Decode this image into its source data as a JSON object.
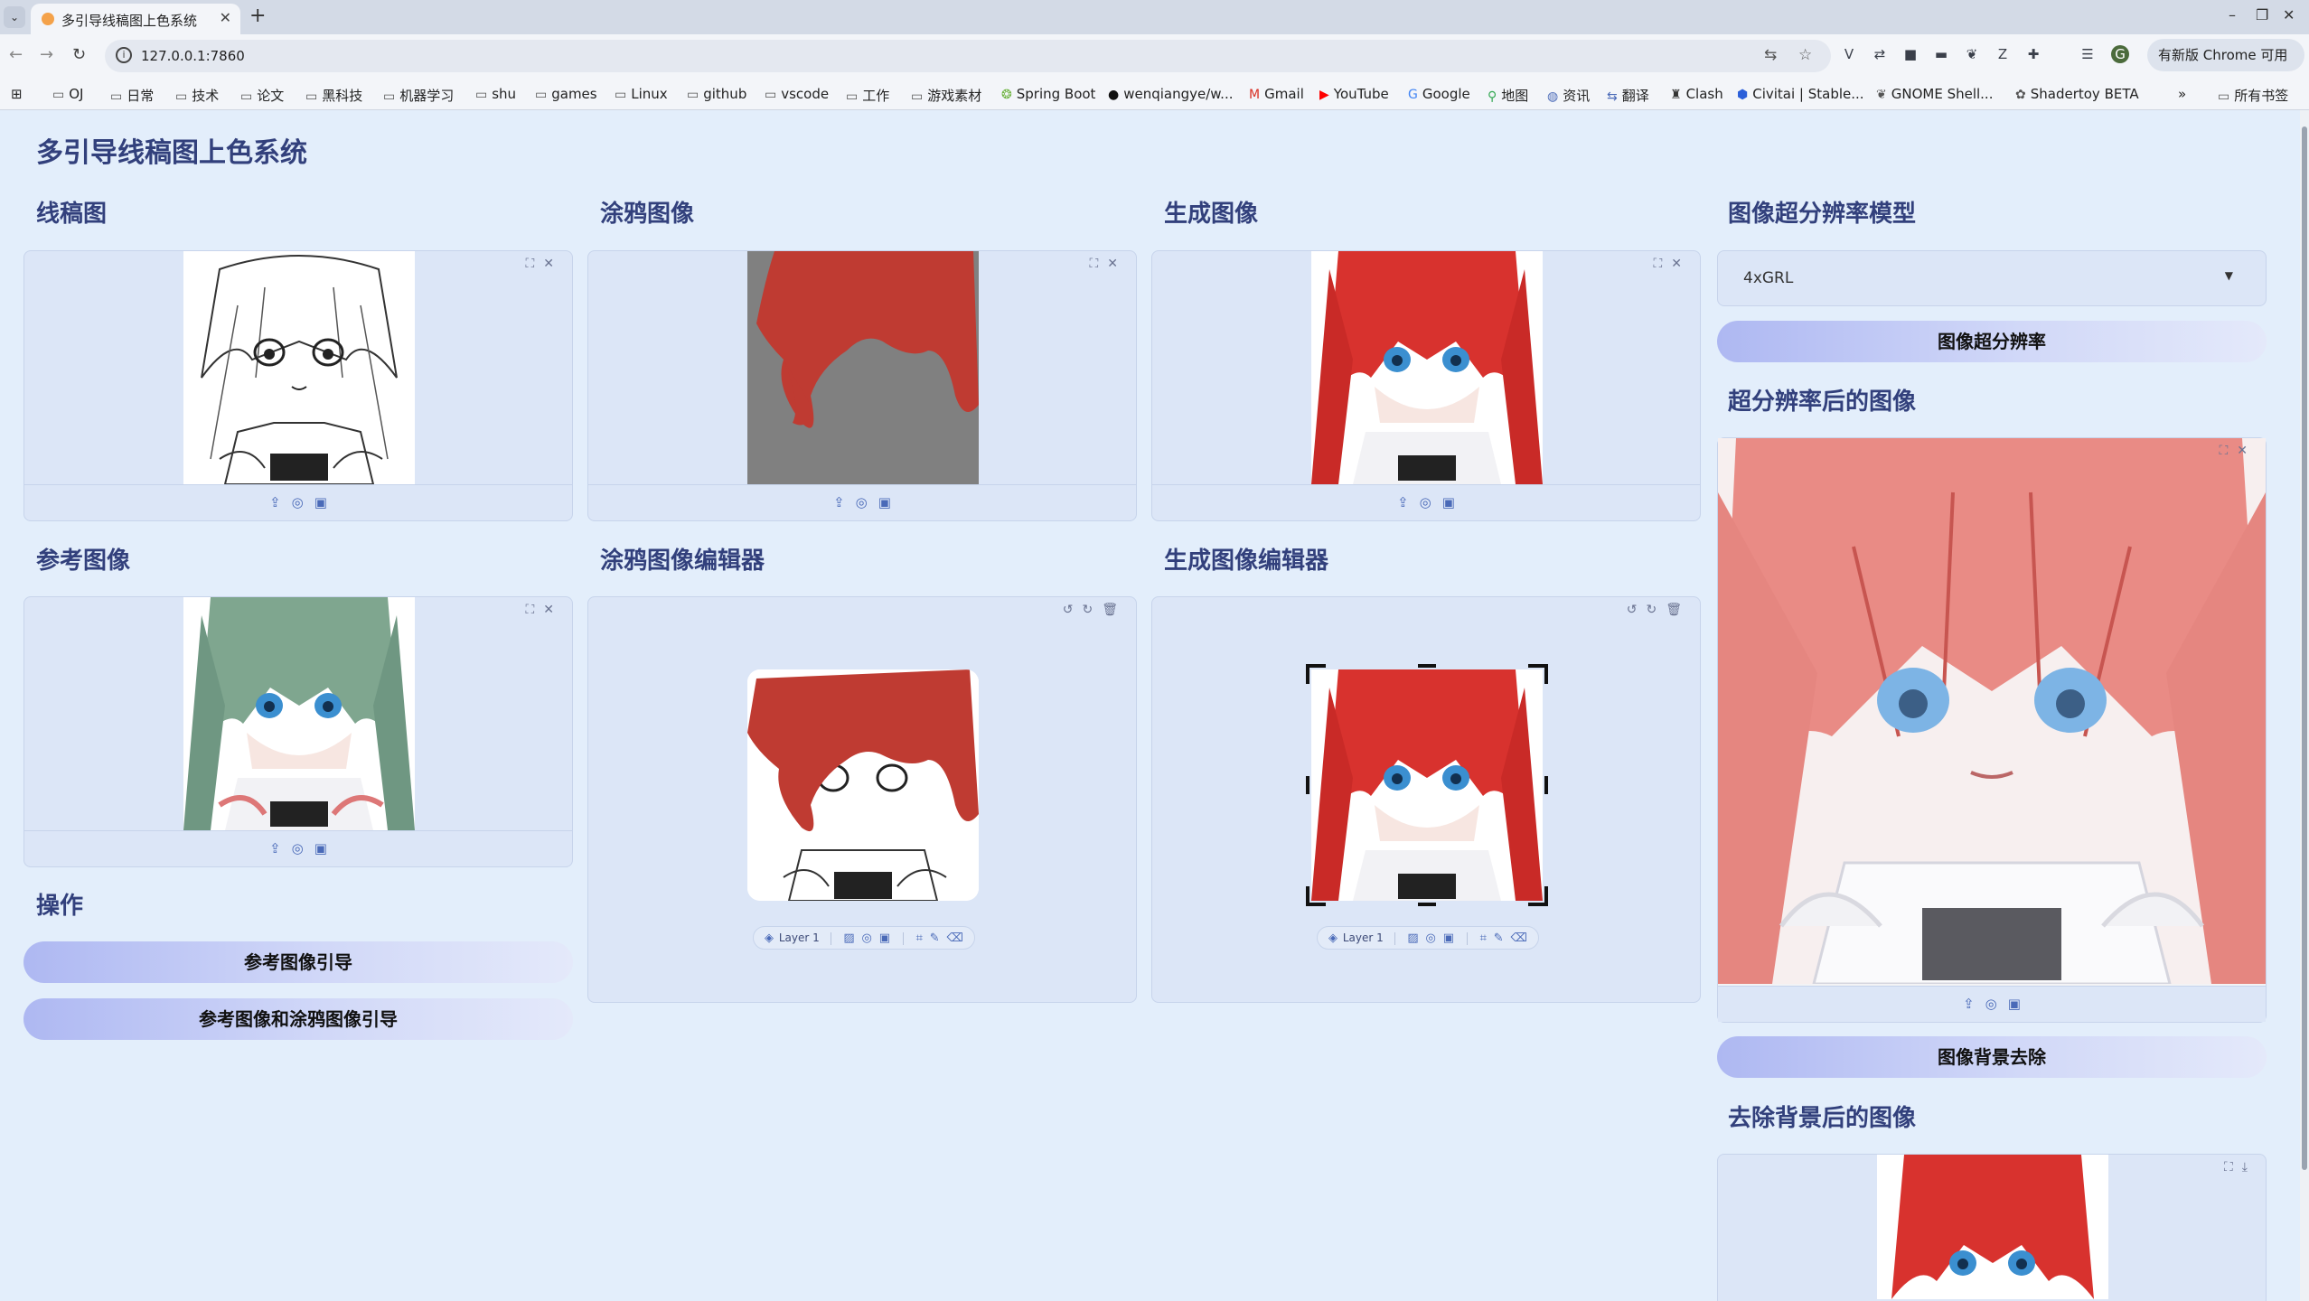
{
  "browser": {
    "tab_title": "多引导线稿图上色系统",
    "url": "127.0.0.1:7860",
    "update_label": "有新版 Chrome 可用",
    "bookmarks": [
      "OJ",
      "日常",
      "技术",
      "论文",
      "黑科技",
      "机器学习",
      "shu",
      "games",
      "Linux",
      "github",
      "vscode",
      "工作",
      "游戏素材",
      "Spring Boot",
      "wenqiangye/w...",
      "Gmail",
      "YouTube",
      "Google",
      "地图",
      "资讯",
      "翻译",
      "Clash",
      "Civitai | Stable...",
      "GNOME Shell...",
      "Shadertoy BETA"
    ],
    "all_bookmarks": "所有书签"
  },
  "app": {
    "title": "多引导线稿图上色系统",
    "sections": {
      "lineart": "线稿图",
      "scribble": "涂鸦图像",
      "generated": "生成图像",
      "sr_model": "图像超分辨率模型",
      "reference": "参考图像",
      "scribble_editor": "涂鸦图像编辑器",
      "generated_editor": "生成图像编辑器",
      "sr_result": "超分辨率后的图像",
      "operations": "操作",
      "bg_removed": "去除背景后的图像"
    },
    "buttons": {
      "ref_guide": "参考图像引导",
      "ref_scribble_guide": "参考图像和涂鸦图像引导",
      "super_resolution": "图像超分辨率",
      "bg_remove": "图像背景去除"
    },
    "sr_model_value": "4xGRL",
    "layer_label": "Layer 1"
  },
  "icons": {
    "upload": "upload-icon",
    "webcam": "webcam-icon",
    "clipboard": "clipboard-icon",
    "fullscreen": "fullscreen-icon",
    "close": "close-icon",
    "undo": "undo-icon",
    "redo": "redo-icon",
    "trash": "trash-icon",
    "download": "download-icon"
  },
  "colors": {
    "title": "#32407c",
    "panel_bg": "#dce6f7",
    "page_bg": "#e3eefb",
    "button_gradient_start": "#aeb8f2",
    "scribble_red": "#c0392b",
    "hair_red": "#d8322e",
    "hair_green": "#7fa68f"
  }
}
